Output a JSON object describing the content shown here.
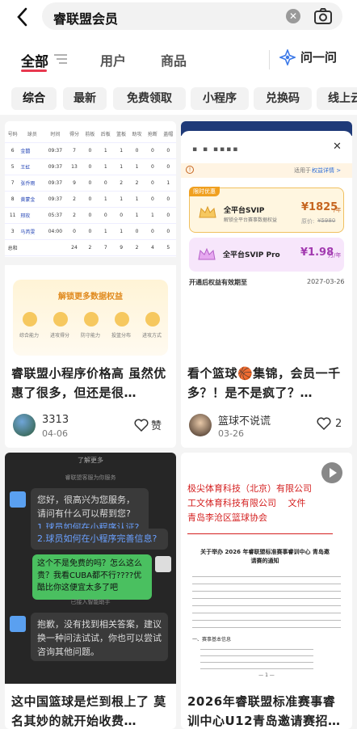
{
  "search": {
    "query": "睿联盟会员"
  },
  "tabs": {
    "all": "全部",
    "users": "用户",
    "goods": "商品",
    "ask": "问一问"
  },
  "chips": [
    "综合",
    "最新",
    "免费领取",
    "小程序",
    "兑换码",
    "线上云"
  ],
  "cards": [
    {
      "title": "睿联盟小程序价格高 虽然优惠了很多，但还是很…",
      "author": "3313",
      "date": "04-06",
      "like_label": "赞",
      "table": {
        "headers": [
          "号码",
          "球员",
          "时间",
          "得分",
          "前板",
          "后板",
          "篮板",
          "助攻",
          "抢断",
          "盖帽"
        ],
        "rows": [
          [
            "6",
            "金囍",
            "09:37",
            "7",
            "0",
            "1",
            "1",
            "0",
            "0",
            "0"
          ],
          [
            "5",
            "王虹",
            "09:37",
            "13",
            "0",
            "1",
            "1",
            "1",
            "0",
            "0"
          ],
          [
            "7",
            "张乔雨",
            "09:37",
            "9",
            "0",
            "0",
            "2",
            "2",
            "0",
            "1"
          ],
          [
            "8",
            "黄蒙金",
            "09:37",
            "2",
            "0",
            "1",
            "1",
            "1",
            "0",
            "0"
          ],
          [
            "11",
            "邢玫",
            "05:37",
            "2",
            "0",
            "0",
            "0",
            "1",
            "1",
            "0"
          ],
          [
            "3",
            "马芮雯",
            "04:00",
            "0",
            "0",
            "1",
            "1",
            "0",
            "0",
            "0"
          ]
        ],
        "total": [
          "总和",
          "",
          "",
          "24",
          "2",
          "7",
          "9",
          "2",
          "4",
          "5"
        ]
      },
      "banner_title": "解锁更多数据权益",
      "banner_items": [
        "综合能力",
        "进攻得分",
        "防守能力",
        "投篮分布",
        "进攻方式"
      ]
    },
    {
      "title": "看个篮球🏀集锦，会员一千多？！是不是疯了？…",
      "author": "篮球不说谎",
      "date": "03-26",
      "like_count": "2",
      "popup": {
        "masked_name": "▪ ▪ ▪▪▪▪",
        "notice_prefix": "适用于",
        "notice_link": "权益详情 >",
        "limited_tag": "限时优惠",
        "plan1_name": "全平台SVIP",
        "plan1_desc": "解锁全平台赛事数据权益",
        "plan1_price": "¥1825",
        "plan1_unit": "/年",
        "plan1_orig_label": "原价:",
        "plan1_orig": "¥5980",
        "plan2_name": "全平台SVIP Pro",
        "plan2_price": "¥1.98",
        "plan2_unit": "万/年",
        "valid_label": "开通后权益有效期至",
        "valid_date": "2027-03-26"
      }
    },
    {
      "title": "这中国篮球是烂到根上了 莫名其妙的就开始收费…",
      "chat": {
        "top": "了解更多",
        "service": "睿联盟客服为你服务",
        "msg1": "您好，很高兴为您服务，请问有什么可以帮到您?",
        "link1": "1.球员如何在小程序认证?",
        "link2": "2.球员如何在小程序完善信息?",
        "user_msg": "这个不是免费的吗？怎么这么贵？我看CUBA都不行????优酷比你这便宜太多了吧",
        "transfer": "已接入智能助手",
        "msg2": "抱歉，没有找到相关答案，建议换一种问法试试，你也可以尝试咨询其他问题。"
      }
    },
    {
      "title": "2026年睿联盟标准赛事睿训中心U12青岛邀请赛招…",
      "doc": {
        "head1": "极尖体育科技（北京）有限公司",
        "head2": "工文体育科技有限公司　 文件",
        "head3": "青岛李沧区篮球协会",
        "notice": "关于举办 2026 年睿联盟标准赛事睿训中心 青岛邀请赛的通知",
        "section": "一、赛事基本信息",
        "page": "— 1 —"
      }
    }
  ],
  "colors": {
    "accent": "#e8384f",
    "vip_orange": "#c6651f",
    "vip_purple": "#a23ab0",
    "link_blue": "#2f6fd8"
  }
}
